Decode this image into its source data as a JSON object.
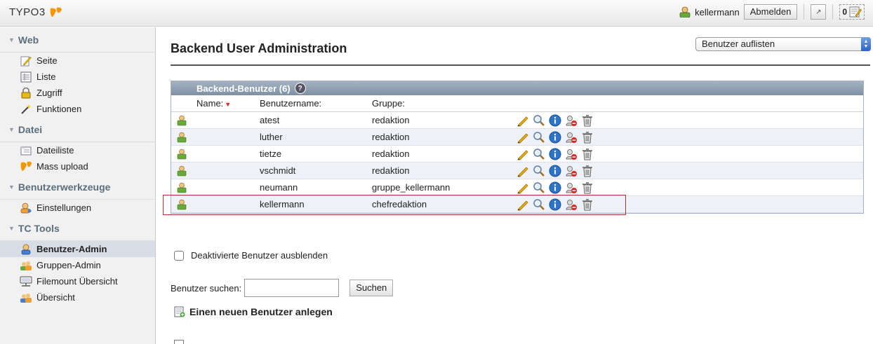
{
  "topbar": {
    "logo_text": "TYPO3",
    "user_name": "kellermann",
    "logout_label": "Abmelden",
    "counter": "0"
  },
  "sidebar": {
    "sections": [
      {
        "label": "Web",
        "items": [
          "Seite",
          "Liste",
          "Zugriff",
          "Funktionen"
        ]
      },
      {
        "label": "Datei",
        "items": [
          "Dateiliste",
          "Mass upload"
        ]
      },
      {
        "label": "Benutzerwerkzeuge",
        "items": [
          "Einstellungen"
        ]
      },
      {
        "label": "TC Tools",
        "items": [
          "Benutzer-Admin",
          "Gruppen-Admin",
          "Filemount Übersicht",
          "Übersicht"
        ]
      }
    ],
    "active_item": "Benutzer-Admin"
  },
  "main": {
    "title": "Backend User Administration",
    "select_value": "Benutzer auflisten",
    "table": {
      "caption": "Backend-Benutzer (6)",
      "columns": [
        "Name:",
        "Benutzername:",
        "Gruppe:"
      ],
      "rows": [
        {
          "username": "atest",
          "group": "redaktion"
        },
        {
          "username": "luther",
          "group": "redaktion"
        },
        {
          "username": "tietze",
          "group": "redaktion"
        },
        {
          "username": "vschmidt",
          "group": "redaktion"
        },
        {
          "username": "neumann",
          "group": "gruppe_kellermann"
        },
        {
          "username": "kellermann",
          "group": "chefredaktion"
        }
      ],
      "highlighted_row": "neumann"
    },
    "hide_disabled_label": "Deaktivierte Benutzer ausblenden",
    "search_label": "Benutzer suchen:",
    "search_value": "",
    "search_button": "Suchen",
    "new_user_label": "Einen neuen Benutzer anlegen"
  },
  "colors": {
    "user_icon_green": "#6aa83a",
    "highlight_border": "#aa3333",
    "table_header": "#8fa0b1"
  }
}
